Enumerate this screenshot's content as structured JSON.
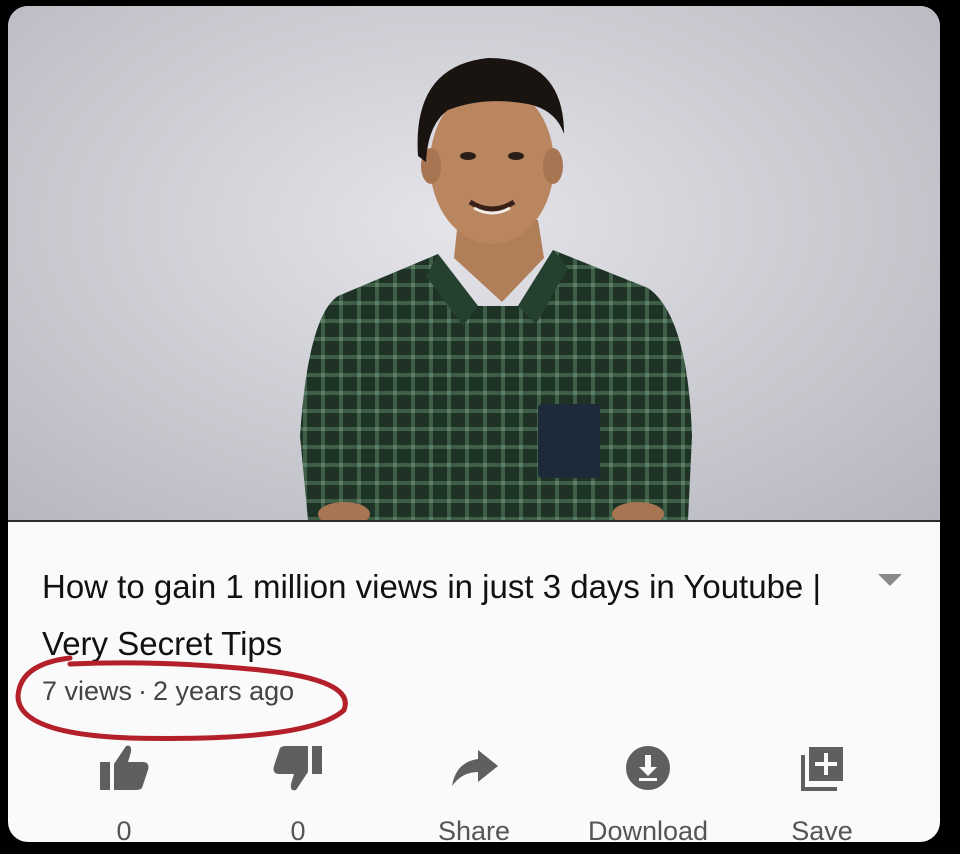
{
  "video": {
    "title": "How to gain 1 million views in just 3 days in Youtube | Very Secret Tips",
    "views": "7 views",
    "separator": "·",
    "age": "2 years ago"
  },
  "actions": {
    "like_count": "0",
    "dislike_count": "0",
    "share_label": "Share",
    "download_label": "Download",
    "save_label": "Save"
  },
  "colors": {
    "annotation": "#b3202a",
    "icon": "#5f5f5f"
  },
  "icons": [
    "thumbs-up-icon",
    "thumbs-down-icon",
    "share-arrow-icon",
    "download-icon",
    "save-playlist-icon",
    "chevron-down-icon"
  ]
}
